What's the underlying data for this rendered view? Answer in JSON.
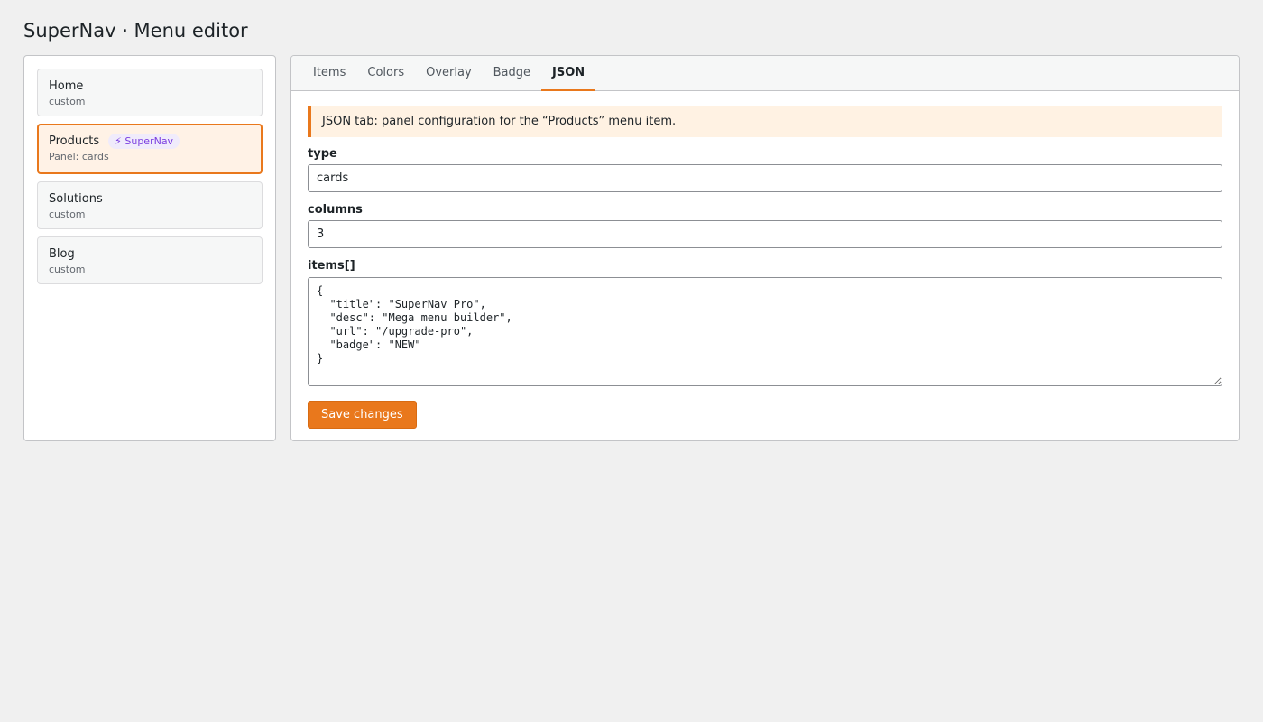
{
  "header": {
    "title": "SuperNav · Menu editor"
  },
  "sidebar": {
    "items": [
      {
        "label": "Home",
        "sub": "custom"
      },
      {
        "label": "Products",
        "badge": "⚡ SuperNav",
        "sub": "Panel: cards",
        "active": true
      },
      {
        "label": "Solutions",
        "sub": "custom"
      },
      {
        "label": "Blog",
        "sub": "custom"
      }
    ]
  },
  "tabs": [
    {
      "label": "Items"
    },
    {
      "label": "Colors"
    },
    {
      "label": "Overlay"
    },
    {
      "label": "Badge"
    },
    {
      "label": "JSON",
      "active": true
    }
  ],
  "notice": "JSON tab: panel configuration for the “Products” menu item.",
  "form": {
    "type_label": "type",
    "type_value": "cards",
    "columns_label": "columns",
    "columns_value": "3",
    "items_label": "items[]",
    "items_value": "{\n  \"title\": \"SuperNav Pro\",\n  \"desc\": \"Mega menu builder\",\n  \"url\": \"/upgrade-pro\",\n  \"badge\": \"NEW\"\n}"
  },
  "save_label": "Save changes",
  "colors": {
    "accent": "#e9781c",
    "badge_text": "#7a3ee0",
    "badge_bg": "#f0ebfb"
  }
}
